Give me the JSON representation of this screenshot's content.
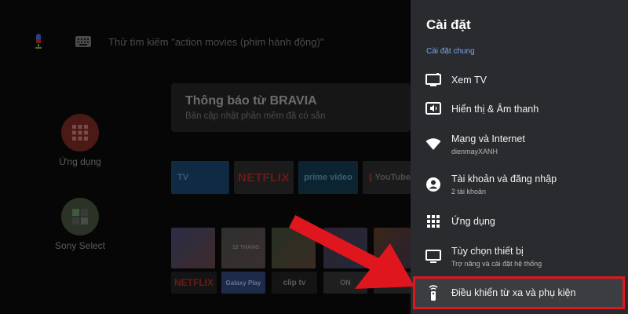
{
  "home": {
    "search_hint": "Thử tìm kiếm \"action movies (phim hành động)\"",
    "notification_title": "Thông báo từ BRAVIA",
    "notification_subtitle": "Bản cập nhật phần mềm đã có sẵn",
    "apps_label": "Ứng dụng",
    "sony_select_label": "Sony Select",
    "app_tiles": [
      "TV",
      "NETFLIX",
      "prime video",
      "YouTube"
    ],
    "poster_labels": [
      "",
      "12 THÁNG",
      "",
      "",
      ""
    ],
    "bottom_tiles": [
      "NETFLIX",
      "Galaxy Play",
      "clip tv",
      "ON",
      ""
    ]
  },
  "settings": {
    "title": "Cài đặt",
    "section_label": "Cài đặt chung",
    "items": [
      {
        "icon": "tv-icon",
        "label": "Xem TV",
        "sublabel": ""
      },
      {
        "icon": "display-sound-icon",
        "label": "Hiển thị & Âm thanh",
        "sublabel": ""
      },
      {
        "icon": "wifi-icon",
        "label": "Mạng và Internet",
        "sublabel": "dienmayXANH"
      },
      {
        "icon": "account-icon",
        "label": "Tài khoản và đăng nhập",
        "sublabel": "2 tài khoản"
      },
      {
        "icon": "apps-grid-icon",
        "label": "Ứng dụng",
        "sublabel": ""
      },
      {
        "icon": "device-preferences-icon",
        "label": "Tùy chọn thiết bị",
        "sublabel": "Trợ năng và cài đặt hệ thống"
      },
      {
        "icon": "remote-icon",
        "label": "Điều khiển từ xa và phụ kiện",
        "sublabel": ""
      }
    ],
    "selected_index": 6
  },
  "colors": {
    "panel_bg": "#292b2e",
    "accent_blue": "#7aa7e6",
    "highlight_red": "#e0161f",
    "annotation_arrow": "#e0161f"
  }
}
